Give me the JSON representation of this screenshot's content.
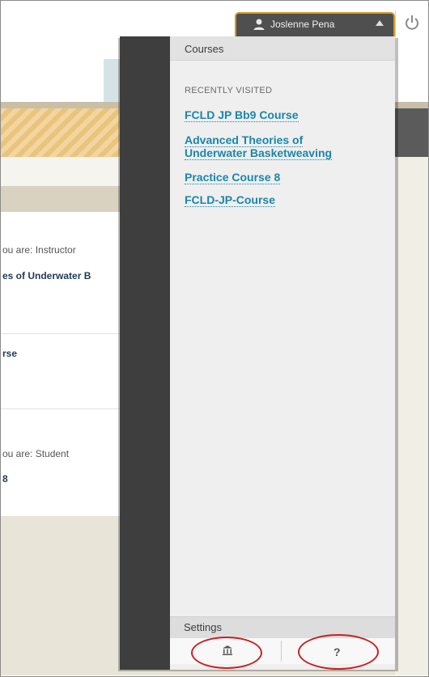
{
  "header": {
    "user_name": "Joslenne Pena"
  },
  "background_page": {
    "role_instructor": "ou are: Instructor",
    "course_partial_1": "es of Underwater B",
    "course_partial_2": "rse",
    "role_student": "ou are: Student",
    "course_partial_3": "8"
  },
  "courses_panel": {
    "title": "Courses",
    "section_label": "RECENTLY VISITED",
    "recent_courses": [
      {
        "line1": "FCLD JP Bb9 Course",
        "line2": ""
      },
      {
        "line1": "Advanced Theories of",
        "line2": "Underwater Basketweaving"
      },
      {
        "line1": "Practice Course 8",
        "line2": ""
      },
      {
        "line1": "FCLD-JP-Course",
        "line2": ""
      }
    ]
  },
  "settings": {
    "title": "Settings",
    "institution_icon": "institution-icon",
    "help_icon": "help-icon",
    "help_label": "?"
  },
  "colors": {
    "link": "#1a86aa",
    "panel_dark": "#3e3e3e",
    "highlight_circle": "#c72224"
  }
}
